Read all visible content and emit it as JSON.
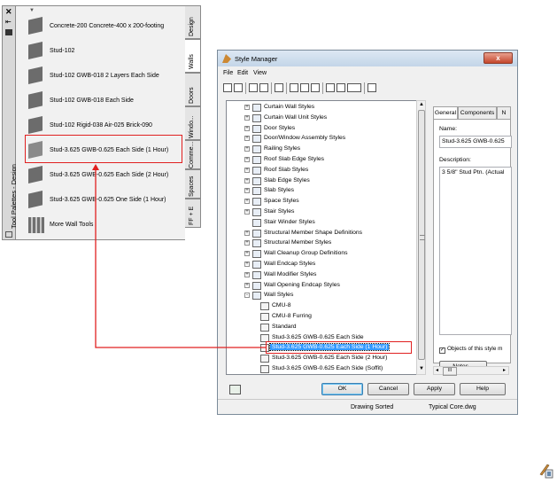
{
  "palette": {
    "title": "Tool Palettes - Design",
    "close_glyph": "✕",
    "items": [
      {
        "label": "Concrete-200 Concrete-400 x 200-footing"
      },
      {
        "label": "Stud-102"
      },
      {
        "label": "Stud-102 GWB-018 2 Layers Each Side"
      },
      {
        "label": "Stud-102 GWB-018 Each Side"
      },
      {
        "label": "Stud-102 Rigid-038 Air-025 Brick-090"
      },
      {
        "label": "Stud-3.625 GWB-0.625 Each Side (1 Hour)"
      },
      {
        "label": "Stud-3.625 GWB-0.625 Each Side (2 Hour)"
      },
      {
        "label": "Stud-3.625 GWB-0.625 One Side (1 Hour)"
      },
      {
        "label": "More Wall Tools"
      }
    ],
    "tabs": [
      {
        "label": "Design"
      },
      {
        "label": "Walls"
      },
      {
        "label": "Doors"
      },
      {
        "label": "Windo..."
      },
      {
        "label": "Comme..."
      },
      {
        "label": "Spaces"
      },
      {
        "label": "FF + E"
      }
    ],
    "active_tab": "Walls"
  },
  "style_manager": {
    "title": "Style Manager",
    "close_glyph": "x",
    "menu": [
      "File",
      "Edit",
      "View"
    ],
    "tree": [
      {
        "label": "Curtain Wall Styles",
        "expander": "+"
      },
      {
        "label": "Curtain Wall Unit Styles",
        "expander": "+"
      },
      {
        "label": "Door Styles",
        "expander": "+"
      },
      {
        "label": "Door/Window Assembly Styles",
        "expander": "+"
      },
      {
        "label": "Railing Styles",
        "expander": "+"
      },
      {
        "label": "Roof Slab Edge Styles",
        "expander": "+"
      },
      {
        "label": "Roof Slab Styles",
        "expander": "+"
      },
      {
        "label": "Slab Edge Styles",
        "expander": "+"
      },
      {
        "label": "Slab Styles",
        "expander": "+"
      },
      {
        "label": "Space Styles",
        "expander": "+"
      },
      {
        "label": "Stair Styles",
        "expander": "+"
      },
      {
        "label": "Stair Winder Styles",
        "expander": ""
      },
      {
        "label": "Structural Member Shape Definitions",
        "expander": "+"
      },
      {
        "label": "Structural Member Styles",
        "expander": "+"
      },
      {
        "label": "Wall Cleanup Group Definitions",
        "expander": "+"
      },
      {
        "label": "Wall Endcap Styles",
        "expander": "+"
      },
      {
        "label": "Wall Modifier Styles",
        "expander": "+"
      },
      {
        "label": "Wall Opening Endcap Styles",
        "expander": "+"
      },
      {
        "label": "Wall Styles",
        "expander": "-"
      },
      {
        "label": "CMU-8",
        "expander": ""
      },
      {
        "label": "CMU-8 Furring",
        "expander": ""
      },
      {
        "label": "Standard",
        "expander": ""
      },
      {
        "label": "Stud-3.625 GWB-0.625 Each Side",
        "expander": ""
      },
      {
        "label": "Stud-3.625 GWB-0.625 Each Side (1 Hour)",
        "expander": ""
      },
      {
        "label": "Stud-3.625 GWB-0.625 Each Side (2 Hour)",
        "expander": ""
      },
      {
        "label": "Stud-3.625 GWB-0.625 Each Side (Soffit)",
        "expander": ""
      }
    ],
    "selected_item": "Stud-3.625 GWB-0.625 Each Side (1 Hour)",
    "right_tabs": [
      "General",
      "Components",
      "N"
    ],
    "name_label": "Name:",
    "name_value": "Stud-3.625 GWB-0.625",
    "description_label": "Description:",
    "description_value": "3 5/8\" Stud Ptn. (Actual",
    "checkbox_label": "Objects of this style m",
    "checkbox_checked": true,
    "notes_button": "Notes...",
    "scroll_left": "◂",
    "scroll_right": "▸",
    "scroll_thumb": "III",
    "buttons": {
      "ok": "OK",
      "cancel": "Cancel",
      "apply": "Apply",
      "help": "Help"
    },
    "status_left": "Drawing Sorted",
    "status_right": "Typical Core.dwg"
  },
  "colors": {
    "highlight": "#e02020",
    "selection": "#3399ff"
  }
}
